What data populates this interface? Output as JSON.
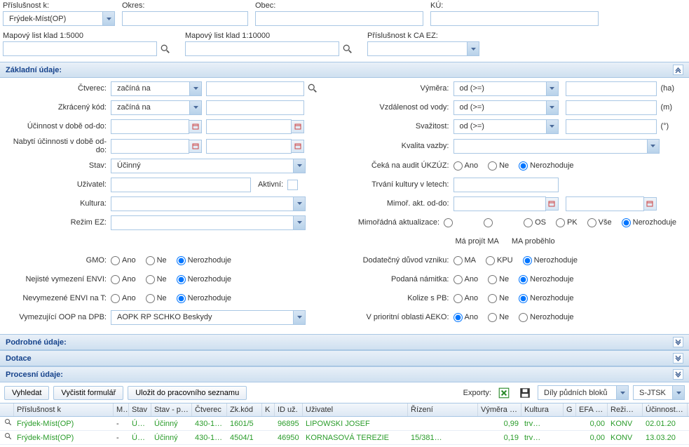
{
  "top": {
    "prislusnost_label": "Příslušnost k:",
    "prislusnost_value": "Frýdek-Míst(OP)",
    "okres_label": "Okres:",
    "obec_label": "Obec:",
    "ku_label": "KÚ:",
    "mapklad5_label": "Mapový list klad 1:5000",
    "mapklad10_label": "Mapový list klad 1:10000",
    "caez_label": "Příslušnost k CA EZ:"
  },
  "panels": {
    "zakladni": "Základní údaje:",
    "podrobne": "Podrobné údaje:",
    "dotace": "Dotace",
    "procesni": "Procesní údaje:"
  },
  "form": {
    "ctverec": "Čtverec:",
    "ctverec_op": "začíná na",
    "vymera": "Výměra:",
    "ha": "(ha)",
    "zkraceny": "Zkrácený kód:",
    "zkraceny_op": "začíná na",
    "vzdalenost": "Vzdálenost od vody:",
    "m": "(m)",
    "ucinnost": "Účinnost v době od-do:",
    "svazitost": "Svažitost:",
    "stupen": "(°)",
    "nabyti": "Nabytí účinnosti v době od-do:",
    "kvalita": "Kvalita vazby:",
    "stav": "Stav:",
    "stav_val": "Účinný",
    "ceka_audit": "Čeká na audit ÚKZÚZ:",
    "uzivatel": "Uživatel:",
    "aktivni": "Aktivní:",
    "trvani": "Trvání kultury v letech:",
    "kultura": "Kultura:",
    "mimor_akt": "Mimoř. akt. od-do:",
    "rezim_ez": "Režim EZ:",
    "mimor_akt2": "Mimořádná aktualizace:",
    "ma_projit": "Má projít MA",
    "ma_probehlo": "MA proběhlo",
    "gmo": "GMO:",
    "dodatecny": "Dodatečný důvod vzniku:",
    "nejiste": "Nejisté vymezení ENVI:",
    "podana": "Podaná námitka:",
    "nevymezene": "Nevymezené ENVI na T:",
    "kolize": "Kolize s PB:",
    "vymezujici": "Vymezující OOP na DPB:",
    "vymezujici_val": "AOPK RP SCHKO Beskydy",
    "vprioritni": "V prioritní oblasti AEKO:",
    "od_ge": "od (>=)",
    "ano": "Ano",
    "ne": "Ne",
    "nerozhoduje": "Nerozhoduje",
    "ma": "MA",
    "kpu": "KPU",
    "os": "OS",
    "pk": "PK",
    "vse": "Vše"
  },
  "toolbar": {
    "vyhledat": "Vyhledat",
    "vycistit": "Vyčistit formulář",
    "ulozit": "Uložit do pracovního seznamu",
    "exporty": "Exporty:",
    "dily": "Díly půdních bloků",
    "sjtsk": "S-JTSK"
  },
  "grid": {
    "headers": {
      "prislusnost": "Příslušnost k",
      "ma": "MA",
      "stav": "Stav",
      "stavpodr": "Stav - podr",
      "ctverec": "Čtverec",
      "zkkod": "Zk.kód",
      "k": "K",
      "iduz": "ID už.",
      "uzivatel": "Uživatel",
      "rizeni": "Řízení",
      "vymera": "Výměra (ha",
      "kultura": "Kultura",
      "g": "G",
      "efa": "EFA (ha",
      "rezime": "Režim E",
      "ucinnostod": "Účinnost od"
    },
    "rows": [
      {
        "prisl": "Frýdek-Míst(OP)",
        "ma": "-",
        "stav": "Úči…",
        "stavp": "Účinný",
        "ctv": "430-1…",
        "zk": "1601/5",
        "iduz": "96895",
        "uziv": "LIPOWSKI JOSEF",
        "riz": "",
        "vym": "0,99",
        "kult": "trv…",
        "efa": "0,00",
        "rez": "KONV",
        "ucod": "02.01.20"
      },
      {
        "prisl": "Frýdek-Míst(OP)",
        "ma": "-",
        "stav": "Úči…",
        "stavp": "Účinný",
        "ctv": "430-1…",
        "zk": "4504/1",
        "iduz": "46950",
        "uziv": "KORNASOVÁ TEREZIE",
        "riz": "15/381…",
        "vym": "0,19",
        "kult": "trv…",
        "efa": "0,00",
        "rez": "KONV",
        "ucod": "13.03.20"
      }
    ]
  }
}
